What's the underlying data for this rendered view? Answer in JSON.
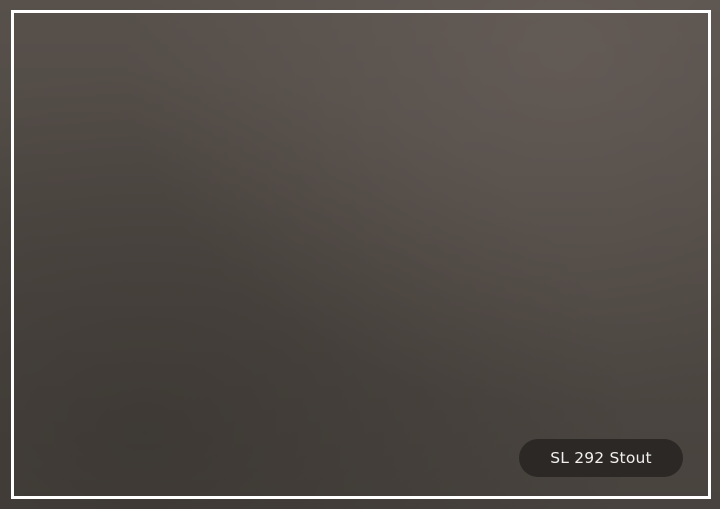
{
  "swatch": {
    "label": "SL 292 Stout",
    "surface_color": "#524c47",
    "frame_color": "#ffffff",
    "badge_color": "#2b2825"
  }
}
